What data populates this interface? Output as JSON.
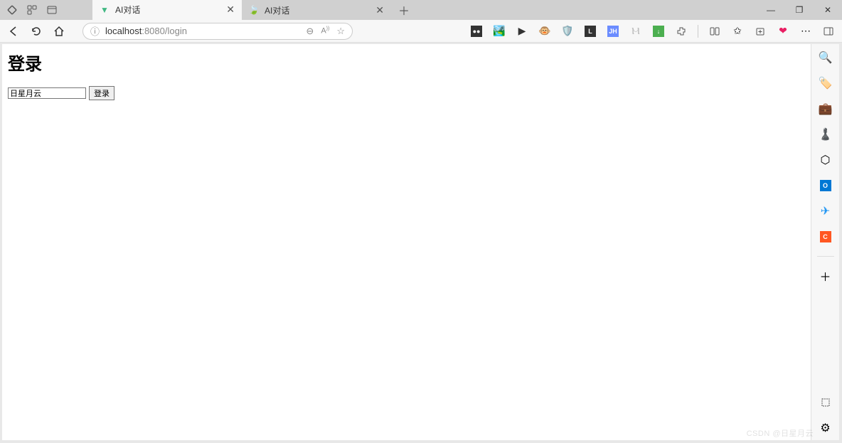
{
  "window": {
    "tabs": [
      {
        "title": "AI对话",
        "favicon": "vue"
      },
      {
        "title": "AI对话",
        "favicon": "leaf"
      }
    ],
    "controls": {
      "min": "—",
      "max": "❐",
      "close": "✕"
    }
  },
  "toolbar": {
    "url_host": "localhost",
    "url_port": ":8080",
    "url_path": "/login"
  },
  "page": {
    "heading": "登录",
    "input_value": "日星月云",
    "submit_label": "登录"
  },
  "sidebar": {
    "plus": "＋"
  },
  "watermark": "CSDN @日星月云"
}
